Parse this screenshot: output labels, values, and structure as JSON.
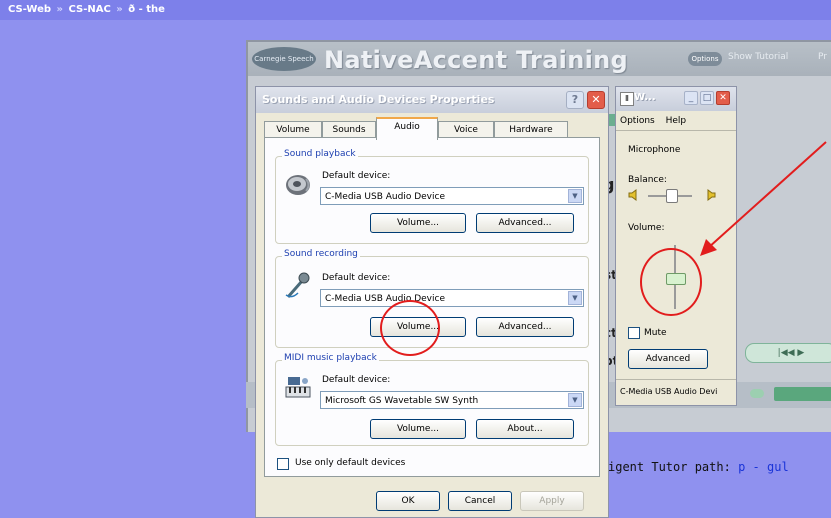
{
  "breadcrumb": {
    "item1": "CS-Web",
    "item2": "CS-NAC",
    "item3": "ð - the"
  },
  "native_accent": {
    "logo_text": "Carnegie Speech",
    "title": "NativeAccent Training",
    "options_label": "Options",
    "show_tutorial_label": "Show Tutorial",
    "pr_label": "Pr",
    "tab1_fragment": "ting",
    "tab2_fragment": "Pr",
    "nav_label": "|◀◀ ▶"
  },
  "tutor_path": {
    "prefix": "igent Tutor path:",
    "link1": "p",
    "dash": "-",
    "link2": "gul"
  },
  "sounds_dialog": {
    "title": "Sounds and Audio Devices Properties",
    "tabs": [
      "Volume",
      "Sounds",
      "Audio",
      "Voice",
      "Hardware"
    ],
    "active_tab": "Audio",
    "playback": {
      "group_label": "Sound playback",
      "default_label": "Default device:",
      "device": "C-Media USB Audio Device",
      "volume_button": "Volume...",
      "advanced_button": "Advanced..."
    },
    "recording": {
      "group_label": "Sound recording",
      "default_label": "Default device:",
      "device": "C-Media USB Audio Device",
      "volume_button": "Volume...",
      "advanced_button": "Advanced..."
    },
    "midi": {
      "group_label": "MIDI music playback",
      "default_label": "Default device:",
      "device": "Microsoft GS Wavetable SW Synth",
      "volume_button": "Volume...",
      "about_button": "About..."
    },
    "use_only_default_label": "Use only default devices",
    "ok_button": "OK",
    "cancel_button": "Cancel",
    "apply_button": "Apply"
  },
  "volume_window": {
    "title": "W...",
    "menu_options": "Options",
    "menu_help": "Help",
    "section_label": "Microphone",
    "balance_label": "Balance:",
    "volume_label": "Volume:",
    "mute_label": "Mute",
    "advanced_button": "Advanced",
    "status_text": "C-Media USB Audio Devi"
  }
}
